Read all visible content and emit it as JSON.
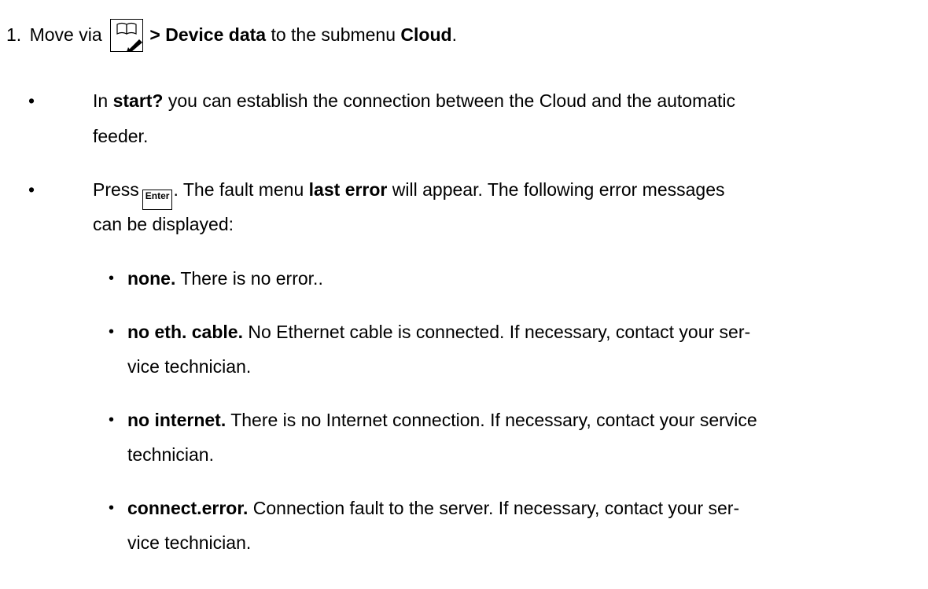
{
  "step": {
    "number": "1.",
    "text_a": "Move via",
    "icon": "manual-book-icon",
    "text_b": "> Device data",
    "text_c": " to the submenu ",
    "text_d": "Cloud",
    "text_e": "."
  },
  "bullet1": {
    "marker": "•",
    "text_a": "In ",
    "text_b": "start?",
    "text_c": " you can establish the connection between the Cloud and the automatic",
    "line2": "feeder."
  },
  "bullet2": {
    "marker": "•",
    "text_a": "Press",
    "key_label": "Enter",
    "text_b": ". The fault menu ",
    "text_c": "last error",
    "text_d": " will appear. The following error messages",
    "line2": "can be displayed:"
  },
  "errors": [
    {
      "marker": "•",
      "term": "none.",
      "desc": " There is no error.."
    },
    {
      "marker": "•",
      "term": "no eth. cable.",
      "desc": " No Ethernet cable is connected. If necessary, contact your ser-",
      "line2": "vice technician."
    },
    {
      "marker": "•",
      "term": "no internet.",
      "desc": " There is no Internet connection. If necessary, contact your service",
      "line2": "technician."
    },
    {
      "marker": "•",
      "term": "connect.error.",
      "desc": " Connection fault to the server. If necessary, contact your ser-",
      "line2": "vice technician."
    }
  ]
}
